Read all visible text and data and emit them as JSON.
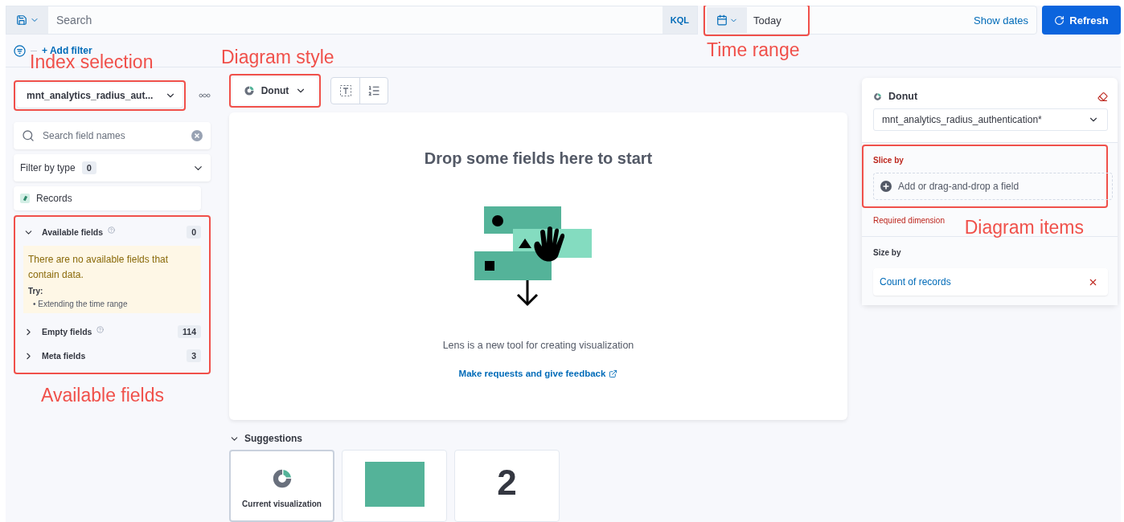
{
  "query_bar": {
    "placeholder": "Search",
    "language": "KQL"
  },
  "time_picker": {
    "value": "Today",
    "show_dates": "Show dates",
    "annotation": "Time range"
  },
  "refresh_button": "Refresh",
  "add_filter": "+ Add filter",
  "sidebar": {
    "index": {
      "value": "mnt_analytics_radius_aut...",
      "annotation": "Index selection"
    },
    "search": {
      "placeholder": "Search field names"
    },
    "filter_by_type": {
      "label": "Filter by type",
      "count": "0"
    },
    "records": "Records",
    "field_groups_annotation": "Available fields",
    "field_groups": [
      {
        "label": "Available fields",
        "count": "0",
        "expanded": true,
        "help": true,
        "callout": {
          "title": "There are no available fields that contain data.",
          "try_label": "Try:",
          "tips": [
            "• Extending the time range"
          ]
        }
      },
      {
        "label": "Empty fields",
        "count": "114",
        "expanded": false,
        "help": true
      },
      {
        "label": "Meta fields",
        "count": "3",
        "expanded": false,
        "help": false
      }
    ]
  },
  "chart_type": {
    "label": "Donut",
    "annotation": "Diagram style"
  },
  "workspace": {
    "title": "Drop some fields here to start",
    "description": "Lens is a new tool for creating visualization",
    "link": "Make requests and give feedback"
  },
  "suggestions": {
    "title": "Suggestions",
    "expanded": true,
    "items": [
      {
        "kind": "donut",
        "label": "Current visualization",
        "selected": true
      },
      {
        "kind": "bar",
        "selected": false
      },
      {
        "kind": "metric",
        "value": "2",
        "selected": false
      }
    ]
  },
  "config_panel": {
    "title": "Donut",
    "index": "mnt_analytics_radius_authentication*",
    "groups": [
      {
        "label": "Slice by",
        "required": true,
        "placeholder": "Add or drag-and-drop a field",
        "error": "Required dimension",
        "annotation": "Diagram items"
      },
      {
        "label": "Size by",
        "required": false,
        "fields": [
          "Count of records"
        ]
      }
    ]
  }
}
